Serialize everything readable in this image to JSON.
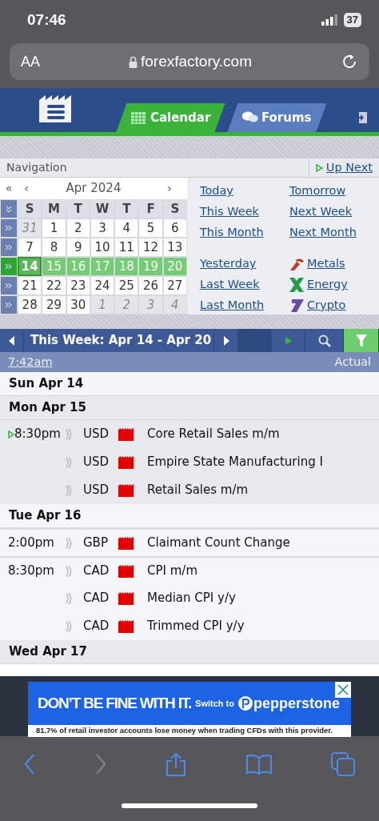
{
  "status_bar": {
    "time": "07:46",
    "battery": "37"
  },
  "url_bar": {
    "text_size": "AA",
    "address": "forexfactory.com"
  },
  "header": {
    "tabs": [
      {
        "label": "Calendar",
        "kind": "calendar",
        "selected": true
      },
      {
        "label": "Forums",
        "kind": "forums",
        "selected": false
      }
    ]
  },
  "navigation": {
    "title": "Navigation",
    "up_next": "Up Next"
  },
  "calendar": {
    "first": "«",
    "prev": "‹",
    "month": "Apr 2024",
    "next": "›",
    "weekdays": [
      "S",
      "M",
      "T",
      "W",
      "T",
      "F",
      "S"
    ],
    "weeks": [
      {
        "selected": false,
        "days": [
          {
            "label": "31",
            "other_month": true,
            "today": false
          },
          {
            "label": "1",
            "other_month": false,
            "today": false
          },
          {
            "label": "2",
            "other_month": false,
            "today": false
          },
          {
            "label": "3",
            "other_month": false,
            "today": false
          },
          {
            "label": "4",
            "other_month": false,
            "today": false
          },
          {
            "label": "5",
            "other_month": false,
            "today": false
          },
          {
            "label": "6",
            "other_month": false,
            "today": false
          }
        ]
      },
      {
        "selected": false,
        "days": [
          {
            "label": "7",
            "other_month": false,
            "today": false
          },
          {
            "label": "8",
            "other_month": false,
            "today": false
          },
          {
            "label": "9",
            "other_month": false,
            "today": false
          },
          {
            "label": "10",
            "other_month": false,
            "today": false
          },
          {
            "label": "11",
            "other_month": false,
            "today": false
          },
          {
            "label": "12",
            "other_month": false,
            "today": false
          },
          {
            "label": "13",
            "other_month": false,
            "today": false
          }
        ]
      },
      {
        "selected": true,
        "days": [
          {
            "label": "14",
            "other_month": false,
            "today": true
          },
          {
            "label": "15",
            "other_month": false,
            "today": false
          },
          {
            "label": "16",
            "other_month": false,
            "today": false
          },
          {
            "label": "17",
            "other_month": false,
            "today": false
          },
          {
            "label": "18",
            "other_month": false,
            "today": false
          },
          {
            "label": "19",
            "other_month": false,
            "today": false
          },
          {
            "label": "20",
            "other_month": false,
            "today": false
          }
        ]
      },
      {
        "selected": false,
        "days": [
          {
            "label": "21",
            "other_month": false,
            "today": false
          },
          {
            "label": "22",
            "other_month": false,
            "today": false
          },
          {
            "label": "23",
            "other_month": false,
            "today": false
          },
          {
            "label": "24",
            "other_month": false,
            "today": false
          },
          {
            "label": "25",
            "other_month": false,
            "today": false
          },
          {
            "label": "26",
            "other_month": false,
            "today": false
          },
          {
            "label": "27",
            "other_month": false,
            "today": false
          }
        ]
      },
      {
        "selected": false,
        "days": [
          {
            "label": "28",
            "other_month": false,
            "today": false
          },
          {
            "label": "29",
            "other_month": false,
            "today": false
          },
          {
            "label": "30",
            "other_month": false,
            "today": false
          },
          {
            "label": "1",
            "other_month": true,
            "today": false
          },
          {
            "label": "2",
            "other_month": true,
            "today": false
          },
          {
            "label": "3",
            "other_month": true,
            "today": false
          },
          {
            "label": "4",
            "other_month": true,
            "today": false
          }
        ]
      }
    ]
  },
  "quick_links": [
    {
      "label": "Today",
      "kind": "plain"
    },
    {
      "label": "Tomorrow",
      "kind": "plain"
    },
    {
      "label": "This Week",
      "kind": "plain"
    },
    {
      "label": "Next Week",
      "kind": "plain"
    },
    {
      "label": "This Month",
      "kind": "plain"
    },
    {
      "label": "Next Month",
      "kind": "plain"
    },
    {
      "label": "Yesterday",
      "kind": "plain"
    },
    {
      "label": "Metals",
      "kind": "metals"
    },
    {
      "label": "Last Week",
      "kind": "plain"
    },
    {
      "label": "Energy",
      "kind": "energy"
    },
    {
      "label": "Last Month",
      "kind": "plain"
    },
    {
      "label": "Crypto",
      "kind": "crypto"
    }
  ],
  "toolbar": {
    "title": "This Week: Apr 14 - Apr 20",
    "filter_active": true
  },
  "table_header": {
    "time": "7:42am",
    "actual": "Actual"
  },
  "days": [
    {
      "label": "Sun Apr 14"
    },
    {
      "label": "Mon Apr 15",
      "events": [
        {
          "time": "8:30pm",
          "up_next": true,
          "currency": "USD",
          "title": "Core Retail Sales m/m"
        },
        {
          "currency": "USD",
          "up_next": false,
          "title": "Empire State Manufacturing I"
        },
        {
          "currency": "USD",
          "up_next": false,
          "title": "Retail Sales m/m"
        }
      ]
    },
    {
      "label": "Tue Apr 16",
      "events": [
        {
          "time": "2:00pm",
          "up_next": false,
          "currency": "GBP",
          "title": "Claimant Count Change",
          "group_start": true
        },
        {
          "time": "8:30pm",
          "up_next": false,
          "currency": "CAD",
          "title": "CPI m/m",
          "group_start": true
        },
        {
          "currency": "CAD",
          "up_next": false,
          "title": "Median CPI y/y",
          "group_start": false
        },
        {
          "currency": "CAD",
          "up_next": false,
          "title": "Trimmed CPI y/y",
          "group_start": false
        }
      ]
    },
    {
      "label": "Wed Apr 17"
    }
  ],
  "ad": {
    "headline": "DON’T BE FINE WITH IT.",
    "switch": "Switch to",
    "brand": "pepperstone",
    "disclaimer": "81.7% of retail investor accounts lose money when trading CFDs with this provider."
  },
  "browser_toolbar": {
    "forward_disabled": true
  }
}
